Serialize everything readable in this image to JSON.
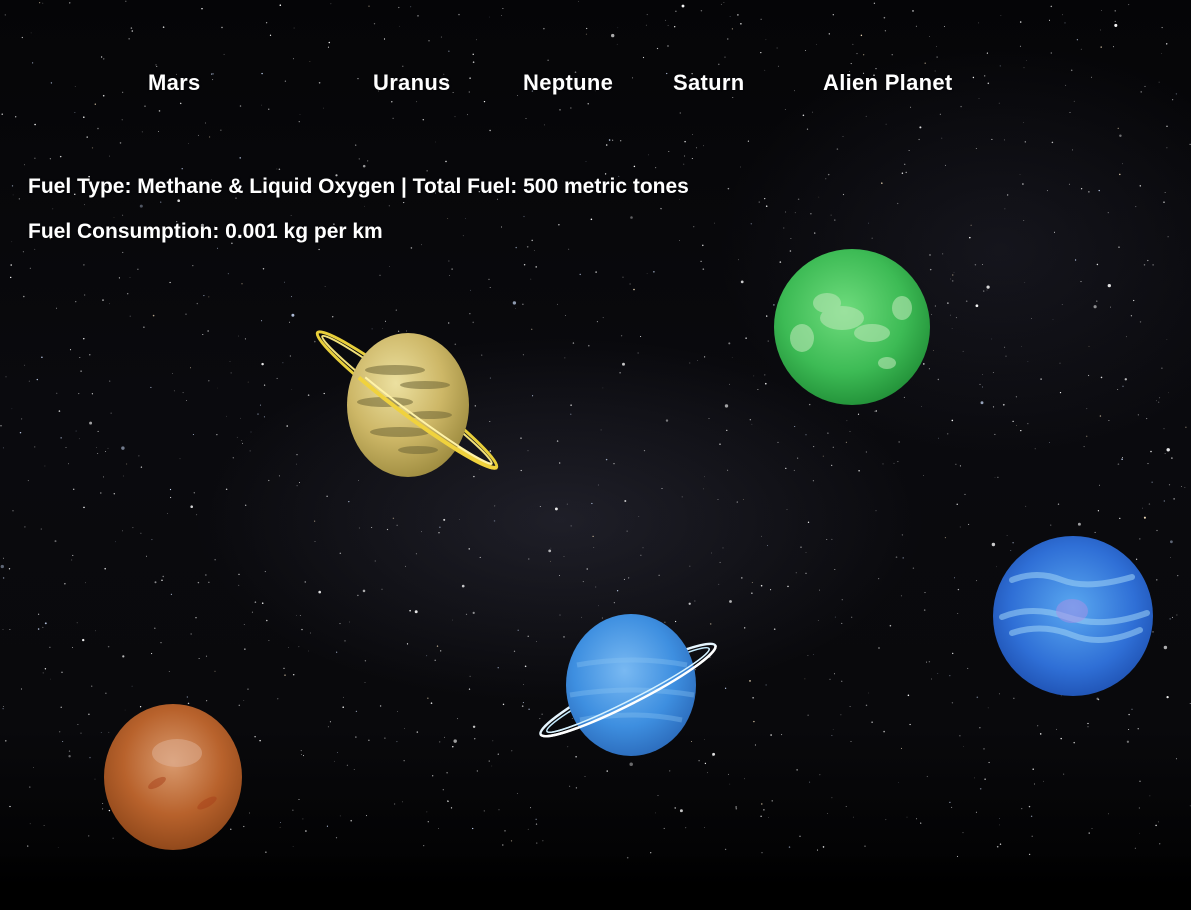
{
  "nav": {
    "mars": "Mars",
    "uranus": "Uranus",
    "neptune": "Neptune",
    "saturn": "Saturn",
    "alien_planet": "Alien Planet"
  },
  "info": {
    "fuel_line": "Fuel Type: Methane & Liquid Oxygen | Total Fuel: 500 metric tones",
    "consumption_line": "Fuel Consumption: 0.001 kg per km"
  },
  "colors": {
    "mars": "#b8622c",
    "saturn": "#cdb767",
    "uranus": "#3e8fe0",
    "neptune": "#2f6fd6",
    "alien_planet": "#3dbb55",
    "text": "#ffffff"
  }
}
